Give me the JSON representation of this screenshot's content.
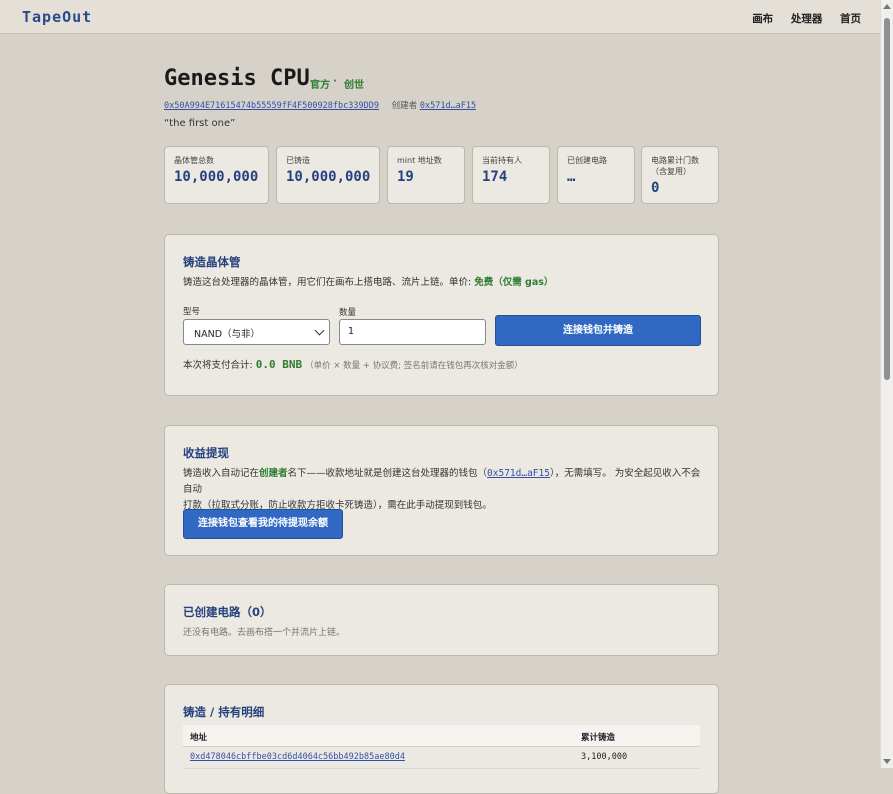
{
  "nav": {
    "logo": "TapeOut",
    "links": [
      "画布",
      "处理器",
      "首页"
    ]
  },
  "header": {
    "title": "Genesis CPU",
    "tag_official": "官方",
    "tag_sep": "·",
    "tag_genesis": "创世",
    "contract_address": "0x50A994E71615474b55559fF4F500928fbc339DD9",
    "creator_label": "创建者",
    "creator_address": "0x571d…aF15",
    "description": "“the first one”"
  },
  "stats": [
    {
      "label": "晶体管总数",
      "value": "10,000,000"
    },
    {
      "label": "已铸造",
      "value": "10,000,000"
    },
    {
      "label": "mint 地址数",
      "value": "19"
    },
    {
      "label": "当前持有人",
      "value": "174"
    },
    {
      "label": "已创建电路",
      "value": "…"
    },
    {
      "label": "电路累计门数（含复用）",
      "value": "0"
    }
  ],
  "mint": {
    "title": "铸造晶体管",
    "desc_prefix": "铸造这台处理器的晶体管，用它们在画布上搭电路、流片上链。单价: ",
    "desc_price": "免费（仅需 gas）",
    "model_label": "型号",
    "model_value": "NAND（与非）",
    "qty_label": "数量",
    "qty_value": "1",
    "button": "连接钱包并铸造",
    "total_label": "本次将支付合计: ",
    "total_value": "0.0 BNB",
    "total_note": "（单价 × 数量 + 协议费; 签名前请在钱包再次核对金额）"
  },
  "withdraw": {
    "title": "收益提现",
    "text_1": "铸造收入自动记在",
    "text_creator": "创建者",
    "text_2": "名下——收款地址就是创建这台处理器的钱包（",
    "text_addr": "0x571d…aF15",
    "text_3": "），无需填写。 为安全起见收入不会自动",
    "text_line2": "打款（拉取式分账，防止收款方拒收卡死铸造），需在此手动提现到钱包。",
    "button": "连接钱包查看我的待提现余额"
  },
  "circuits": {
    "title": "已创建电路（0）",
    "empty": "还没有电路。去画布搭一个并流片上链。"
  },
  "holdings": {
    "title": "铸造 / 持有明细",
    "col_address": "地址",
    "col_minted": "累计铸造",
    "rows": [
      {
        "address": "0xd478046cbffbe03cd6d4064c56bb492b85ae80d4",
        "minted": "3,100,000"
      }
    ]
  }
}
